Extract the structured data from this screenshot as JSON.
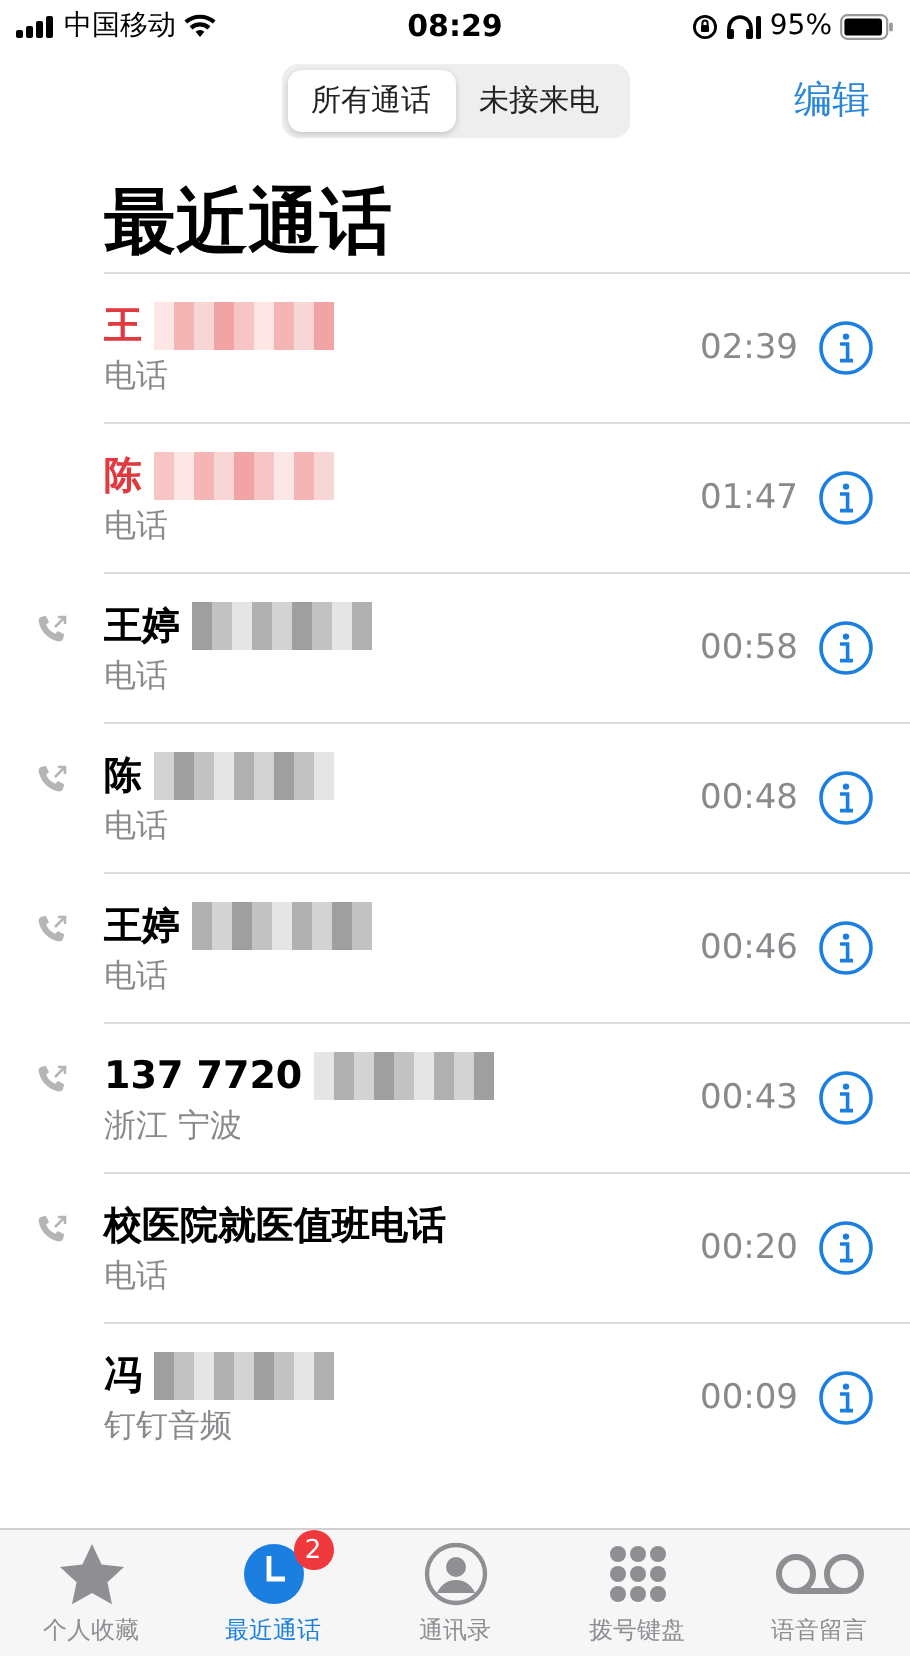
{
  "status_bar": {
    "carrier": "中国移动",
    "time": "08:29",
    "battery": "95%"
  },
  "segments": [
    {
      "label": "所有通话",
      "selected": true
    },
    {
      "label": "未接来电",
      "selected": false
    }
  ],
  "edit_button": "编辑",
  "title": "最近通话",
  "calls": [
    {
      "name": "王",
      "subtitle": "电话",
      "time": "02:39",
      "kind": "missed",
      "redacted": true
    },
    {
      "name": "陈",
      "subtitle": "电话",
      "time": "01:47",
      "kind": "missed",
      "redacted": true
    },
    {
      "name": "王婷",
      "subtitle": "电话",
      "time": "00:58",
      "kind": "outgoing",
      "redacted": true
    },
    {
      "name": "陈",
      "subtitle": "电话",
      "time": "00:48",
      "kind": "outgoing",
      "redacted": true
    },
    {
      "name": "王婷",
      "subtitle": "电话",
      "time": "00:46",
      "kind": "outgoing",
      "redacted": true
    },
    {
      "name": "137 7720",
      "subtitle": "浙江 宁波",
      "time": "00:43",
      "kind": "outgoing",
      "redacted": true
    },
    {
      "name": "校医院就医值班电话",
      "subtitle": "电话",
      "time": "00:20",
      "kind": "outgoing",
      "redacted": false
    },
    {
      "name": "冯",
      "subtitle": "钉钉音频",
      "time": "00:09",
      "kind": "incoming",
      "redacted": true
    }
  ],
  "tab_bar": [
    {
      "label": "个人收藏",
      "kind": "star",
      "selected": false
    },
    {
      "label": "最近通话",
      "kind": "clock",
      "selected": true,
      "badge": "2"
    },
    {
      "label": "通讯录",
      "kind": "contact",
      "selected": false
    },
    {
      "label": "拨号键盘",
      "kind": "keypad",
      "selected": false
    },
    {
      "label": "语音留言",
      "kind": "voicemail",
      "selected": false
    }
  ]
}
